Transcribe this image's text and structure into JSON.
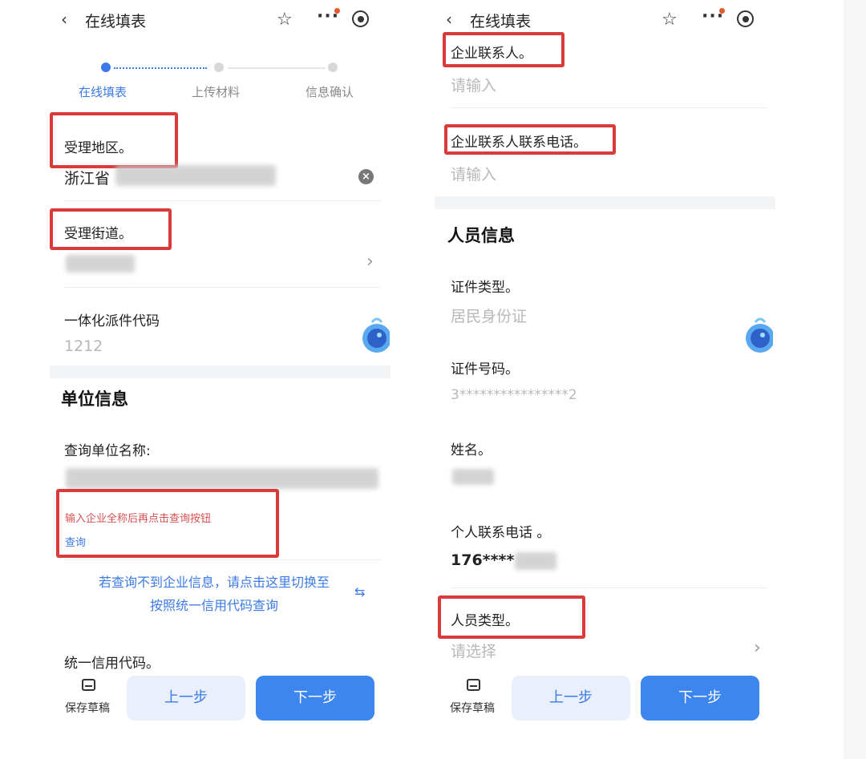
{
  "left": {
    "topbar": {
      "back_icon": "‹",
      "title": "在线填表"
    },
    "steps": [
      {
        "label": "在线填表",
        "active": true
      },
      {
        "label": "上传材料",
        "active": false
      },
      {
        "label": "信息确认",
        "active": false
      }
    ],
    "fields": {
      "region_label": "受理地区",
      "region_value": "浙江省",
      "street_label": "受理街道",
      "dispatch_label": "一体化派件代码",
      "dispatch_value": "1212"
    },
    "unit_section": {
      "title": "单位信息",
      "query_label": "查询单位名称:",
      "hint": "输入企业全称后再点击查询按钮",
      "query_button": "查询",
      "switch_link_line1": "若查询不到企业信息，请点击这里切换至",
      "switch_link_line2": "按照统一信用代码查询",
      "switch_icon": "⇆",
      "credit_code_label": "统一信用代码"
    },
    "bottom": {
      "draft_label": "保存草稿",
      "prev_label": "上一步",
      "next_label": "下一步"
    }
  },
  "right": {
    "topbar": {
      "back_icon": "‹",
      "title": "在线填表"
    },
    "fields": {
      "contact_label": "企业联系人",
      "contact_placeholder": "请输入",
      "contact_phone_label": "企业联系人联系电话",
      "contact_phone_placeholder": "请输入"
    },
    "person_section": {
      "title": "人员信息",
      "id_type_label": "证件类型",
      "id_type_value": "居民身份证",
      "id_no_label": "证件号码",
      "id_no_value": "3****************2",
      "name_label": "姓名",
      "phone_label": "个人联系电话",
      "phone_value": "176****",
      "person_type_label": "人员类型",
      "person_type_placeholder": "请选择"
    },
    "bottom": {
      "draft_label": "保存草稿",
      "prev_label": "上一步",
      "next_label": "下一步"
    }
  },
  "icons": {
    "star": "☆",
    "more": "···",
    "chevron": "›",
    "clear": "×"
  },
  "colors": {
    "accent": "#3b7ae6",
    "highlight_box": "#d93a3a",
    "next_button": "#3d86ee",
    "prev_button_bg": "#e9f0fc"
  }
}
